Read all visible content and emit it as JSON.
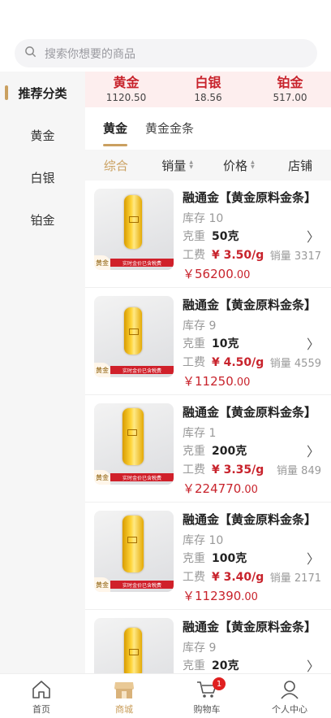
{
  "search": {
    "placeholder": "搜索你想要的商品"
  },
  "sidebar": {
    "items": [
      {
        "label": "推荐分类"
      },
      {
        "label": "黄金"
      },
      {
        "label": "白银"
      },
      {
        "label": "铂金"
      }
    ]
  },
  "prices": [
    {
      "name": "黄金",
      "value": "1120.50"
    },
    {
      "name": "白银",
      "value": "18.56"
    },
    {
      "name": "铂金",
      "value": "517.00"
    }
  ],
  "subtabs": [
    {
      "label": "黄金"
    },
    {
      "label": "黄金金条"
    }
  ],
  "sort": [
    {
      "label": "综合"
    },
    {
      "label": "销量"
    },
    {
      "label": "价格"
    },
    {
      "label": "店铺"
    }
  ],
  "product_labels": {
    "stock": "库存",
    "weight": "克重",
    "fee": "工费",
    "sales": "销量",
    "thumb_tag": "黄金",
    "thumb_strip": "实时金价已含税费",
    "currency": "￥"
  },
  "products": [
    {
      "title": "融通金【黄金原料金条】",
      "stock": "10",
      "weight": "50克",
      "fee": "¥ 3.50/g",
      "sales": "3317",
      "price_int": "56200",
      "price_dec": ".00"
    },
    {
      "title": "融通金【黄金原料金条】",
      "stock": "9",
      "weight": "10克",
      "fee": "¥ 4.50/g",
      "sales": "4559",
      "price_int": "11250",
      "price_dec": ".00"
    },
    {
      "title": "融通金【黄金原料金条】",
      "stock": "1",
      "weight": "200克",
      "fee": "¥ 3.35/g",
      "sales": "849",
      "price_int": "224770",
      "price_dec": ".00"
    },
    {
      "title": "融通金【黄金原料金条】",
      "stock": "10",
      "weight": "100克",
      "fee": "¥ 3.40/g",
      "sales": "2171",
      "price_int": "112390",
      "price_dec": ".00"
    },
    {
      "title": "融通金【黄金原料金条】",
      "stock": "9",
      "weight": "20克",
      "fee": "",
      "sales": "",
      "price_int": "",
      "price_dec": ""
    }
  ],
  "bottom_nav": [
    {
      "label": "首页"
    },
    {
      "label": "商城"
    },
    {
      "label": "购物车",
      "badge": "1"
    },
    {
      "label": "个人中心"
    }
  ],
  "colors": {
    "accent": "#caa060",
    "price": "#c8232c"
  }
}
